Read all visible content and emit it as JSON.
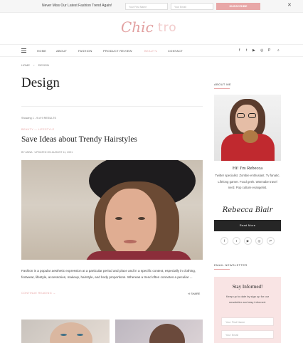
{
  "topbar": {
    "message": "Never Miss Our Latest Fashion Trend Again!",
    "first_name_placeholder": "Your First Name",
    "email_placeholder": "Your Email",
    "subscribe_label": "SUBSCRIBE",
    "close_glyph": "✕",
    "accent": "#e8a7a7"
  },
  "logo": {
    "part1": "Chic",
    "part2": "tro"
  },
  "nav": {
    "items": [
      "HOME",
      "ABOUT",
      "FASHION",
      "PRODUCT REVIEW",
      "BEAUTY",
      "CONTACT"
    ],
    "active_index": 4,
    "dropdown_glyph": "⌄",
    "social_icons": [
      "facebook-icon",
      "twitter-icon",
      "youtube-icon",
      "instagram-icon",
      "pinterest-icon",
      "search-icon"
    ],
    "social_glyphs": [
      "f",
      "t",
      "▶",
      "◎",
      "P",
      "⌕"
    ]
  },
  "breadcrumb": {
    "home": "HOME",
    "sep": "›",
    "current": "DESIGN"
  },
  "page": {
    "title": "Design",
    "showing": "Showing 1 - 9 of 9 RESULTS",
    "post": {
      "categories": "BEAUTY  —  LIFESTYLE",
      "title": "Save Ideas about Trendy Hairstyles",
      "meta": "BY ANNA  ·  UPDATED ON AUGUST 11, 2021",
      "excerpt": "Fashion is a popular aesthetic expression at a particular period and place and in a specific context, especially in clothing, footwear, lifestyle, accessories, makeup, hairstyle, and body proportions. Whereas a trend often connotes a peculiar ...",
      "continue_label": "CONTINUE READING",
      "share_label": "SHARE"
    }
  },
  "sidebar": {
    "about_heading": "ABOUT ME",
    "greeting": "Hi! I'm Rebecca",
    "bio": "Twitter specialist. Zombie enthusiast. Tv fanatic. Lifelong gamer. Food geek. Wannabe travel nerd. Pop culture evangelist.",
    "signature": "Rebecca Blair",
    "read_more_label": "Read More",
    "social_glyphs": [
      "f",
      "t",
      "▶",
      "◎",
      "P"
    ],
    "newsletter_heading": "EMAIL NEWSLETTER",
    "newsletter": {
      "title": "Stay Informed!",
      "description": "Keep up to date by sign up for our newsletter and stay informed.",
      "first_name_placeholder": "Your First Name",
      "email_placeholder": "Your Email"
    }
  }
}
